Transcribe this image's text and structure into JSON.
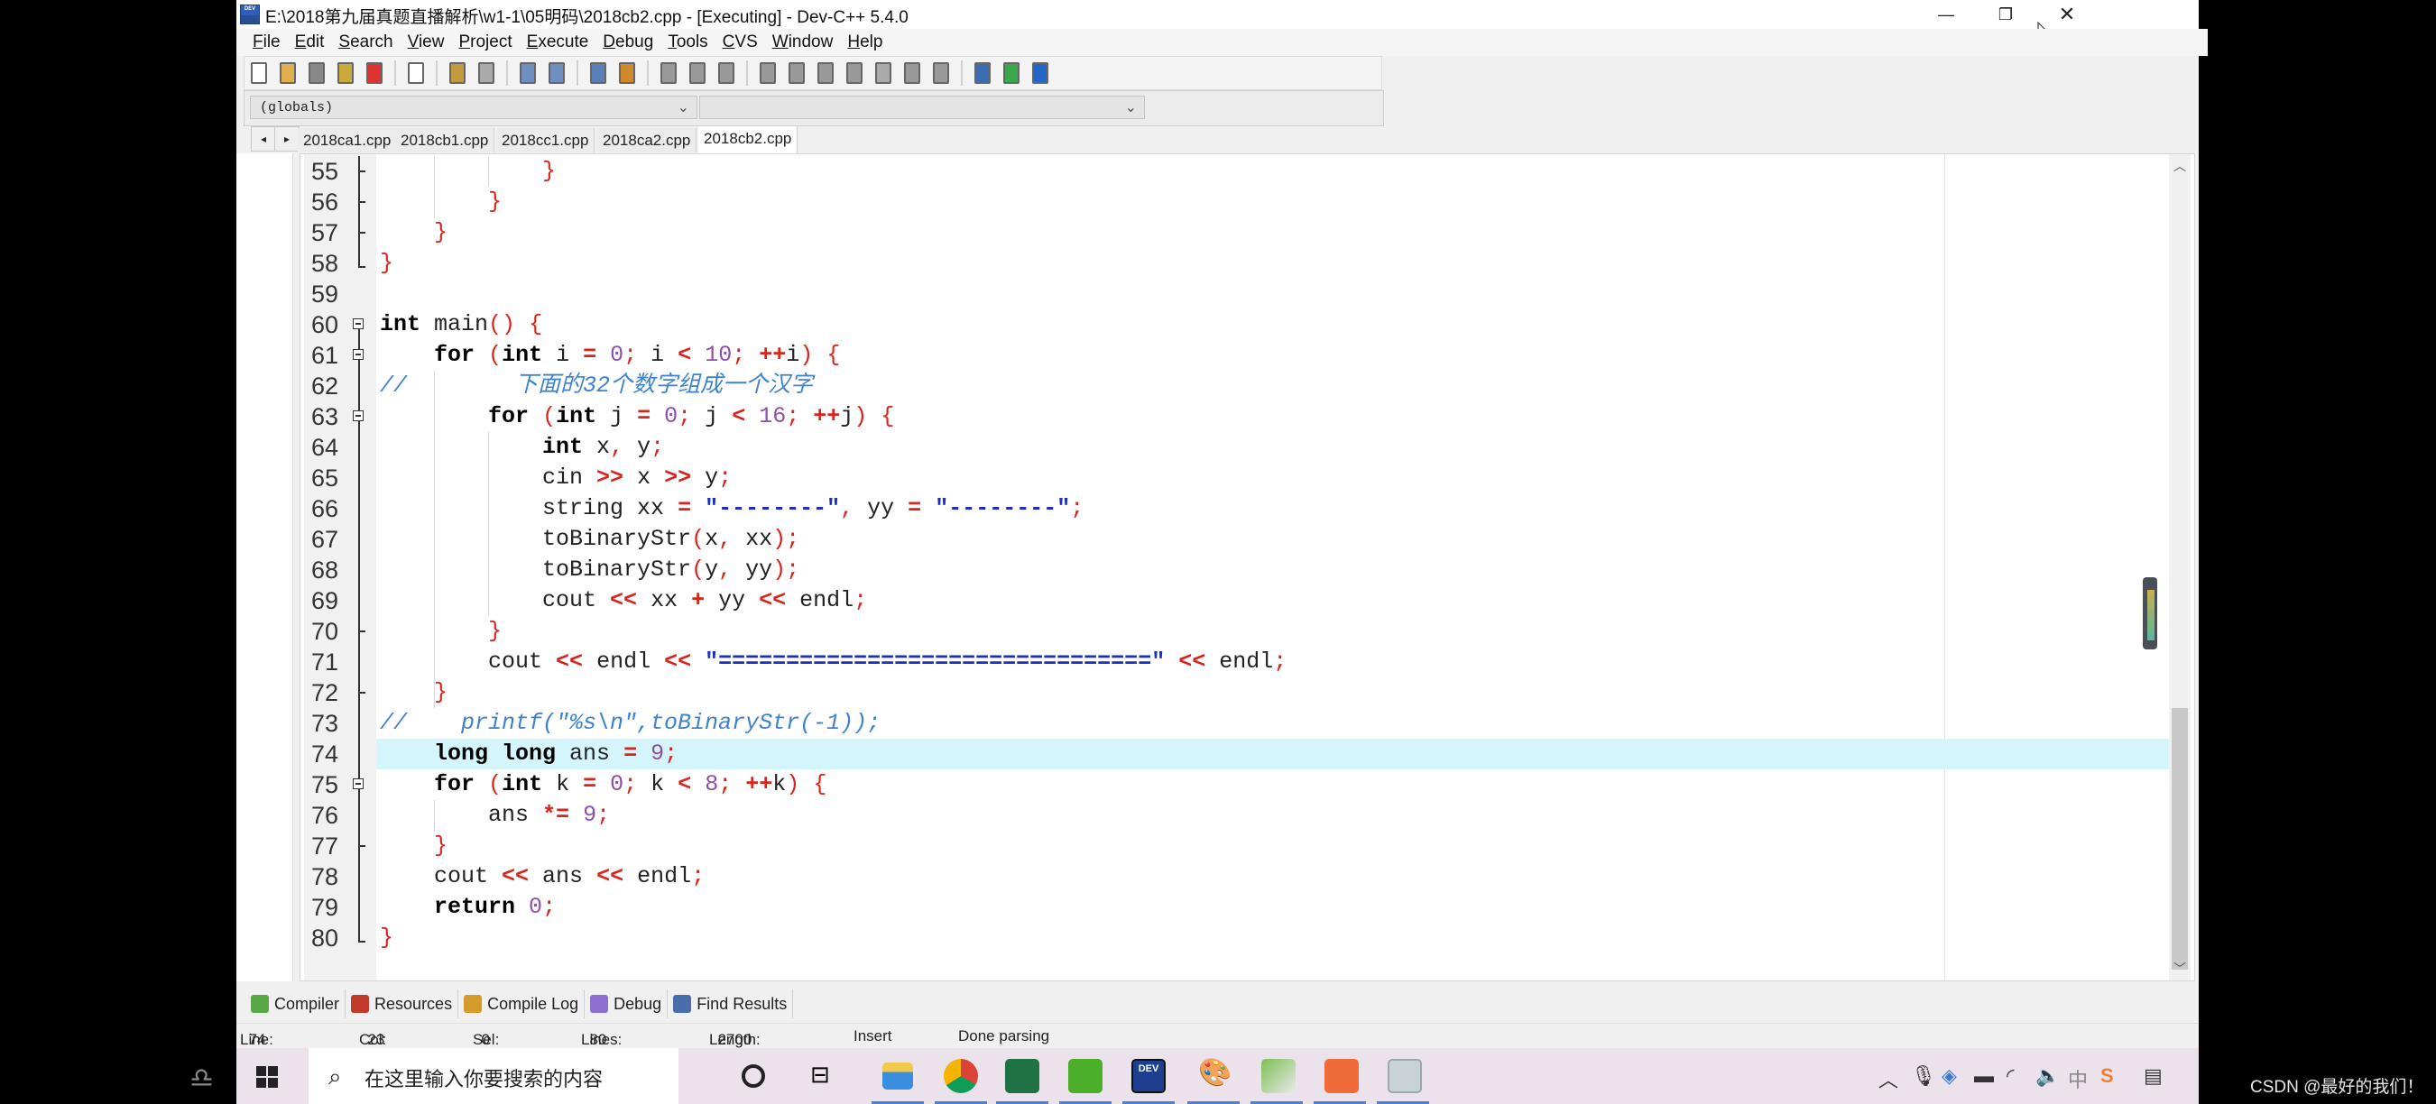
{
  "window": {
    "title": "E:\\2018第九届真题直播解析\\w1-1\\05明码\\2018cb2.cpp - [Executing] - Dev-C++ 5.4.0",
    "app_icon_text": "DEV",
    "controls": {
      "minimize": "—",
      "restore": "❐",
      "close": "✕"
    }
  },
  "menu": [
    {
      "label": "File",
      "mnemonic": "F",
      "rest": "ile"
    },
    {
      "label": "Edit",
      "mnemonic": "E",
      "rest": "dit"
    },
    {
      "label": "Search",
      "mnemonic": "S",
      "rest": "earch"
    },
    {
      "label": "View",
      "mnemonic": "V",
      "rest": "iew"
    },
    {
      "label": "Project",
      "mnemonic": "P",
      "rest": "roject"
    },
    {
      "label": "Execute",
      "mnemonic": "E",
      "rest": "xecute",
      "pre": ""
    },
    {
      "label": "Debug",
      "mnemonic": "D",
      "rest": "ebug"
    },
    {
      "label": "Tools",
      "mnemonic": "T",
      "rest": "ools"
    },
    {
      "label": "CVS",
      "mnemonic": "C",
      "rest": "VS"
    },
    {
      "label": "Window",
      "mnemonic": "W",
      "rest": "indow"
    },
    {
      "label": "Help",
      "mnemonic": "H",
      "rest": "elp"
    }
  ],
  "toolbar": {
    "groups": [
      [
        "new-file",
        "open-file",
        "save-file",
        "save-all",
        "close-file"
      ],
      [
        "print"
      ],
      [
        "undo",
        "redo"
      ],
      [
        "find",
        "replace"
      ],
      [
        "goto-line",
        "toggle-bookmark"
      ],
      [
        "indent",
        "unindent",
        "toggle-comment"
      ],
      [
        "compile",
        "run",
        "compile-run",
        "rebuild",
        "syntax-check",
        "debug",
        "stop-execution"
      ],
      [
        "new-project",
        "add-to-project",
        "project-options"
      ]
    ]
  },
  "combos": {
    "class_selector": "(globals)",
    "member_selector": ""
  },
  "file_tabs": {
    "nav_left": "◂",
    "nav_right": "▸",
    "tabs": [
      "2018ca1.cpp",
      "2018cb1.cpp",
      "2018cc1.cpp",
      "2018ca2.cpp",
      "2018cb2.cpp"
    ],
    "active": "2018cb2.cpp"
  },
  "editor": {
    "highlighted_line": 74,
    "lines": [
      {
        "num": "55",
        "fold": "mid",
        "tokens": [
          {
            "t": "            ",
            "c": ""
          },
          {
            "t": "}",
            "c": "p"
          }
        ]
      },
      {
        "num": "56",
        "fold": "mid",
        "tokens": [
          {
            "t": "        ",
            "c": ""
          },
          {
            "t": "}",
            "c": "p"
          }
        ]
      },
      {
        "num": "57",
        "fold": "mid",
        "tokens": [
          {
            "t": "    ",
            "c": ""
          },
          {
            "t": "}",
            "c": "p"
          }
        ]
      },
      {
        "num": "58",
        "fold": "end",
        "tokens": [
          {
            "t": "}",
            "c": "p"
          }
        ]
      },
      {
        "num": "59",
        "fold": "",
        "tokens": []
      },
      {
        "num": "60",
        "fold": "box",
        "tokens": [
          {
            "t": "int",
            "c": "k"
          },
          {
            "t": " main",
            "c": ""
          },
          {
            "t": "()",
            "c": "p"
          },
          {
            "t": " ",
            "c": ""
          },
          {
            "t": "{",
            "c": "p"
          }
        ]
      },
      {
        "num": "61",
        "fold": "box",
        "tokens": [
          {
            "t": "    ",
            "c": ""
          },
          {
            "t": "for",
            "c": "k"
          },
          {
            "t": " ",
            "c": ""
          },
          {
            "t": "(",
            "c": "p"
          },
          {
            "t": "int",
            "c": "k"
          },
          {
            "t": " i ",
            "c": ""
          },
          {
            "t": "=",
            "c": "o"
          },
          {
            "t": " ",
            "c": ""
          },
          {
            "t": "0",
            "c": "n"
          },
          {
            "t": ";",
            "c": "p"
          },
          {
            "t": " i ",
            "c": ""
          },
          {
            "t": "<",
            "c": "o"
          },
          {
            "t": " ",
            "c": ""
          },
          {
            "t": "10",
            "c": "n"
          },
          {
            "t": ";",
            "c": "p"
          },
          {
            "t": " ",
            "c": ""
          },
          {
            "t": "++",
            "c": "o"
          },
          {
            "t": "i",
            "c": ""
          },
          {
            "t": ")",
            "c": "p"
          },
          {
            "t": " ",
            "c": ""
          },
          {
            "t": "{",
            "c": "p"
          }
        ]
      },
      {
        "num": "62",
        "fold": "line",
        "tokens": [
          {
            "t": "//        下面的32个数字组成一个汉字",
            "c": "c"
          }
        ]
      },
      {
        "num": "63",
        "fold": "box",
        "tokens": [
          {
            "t": "        ",
            "c": ""
          },
          {
            "t": "for",
            "c": "k"
          },
          {
            "t": " ",
            "c": ""
          },
          {
            "t": "(",
            "c": "p"
          },
          {
            "t": "int",
            "c": "k"
          },
          {
            "t": " j ",
            "c": ""
          },
          {
            "t": "=",
            "c": "o"
          },
          {
            "t": " ",
            "c": ""
          },
          {
            "t": "0",
            "c": "n"
          },
          {
            "t": ";",
            "c": "p"
          },
          {
            "t": " j ",
            "c": ""
          },
          {
            "t": "<",
            "c": "o"
          },
          {
            "t": " ",
            "c": ""
          },
          {
            "t": "16",
            "c": "n"
          },
          {
            "t": ";",
            "c": "p"
          },
          {
            "t": " ",
            "c": ""
          },
          {
            "t": "++",
            "c": "o"
          },
          {
            "t": "j",
            "c": ""
          },
          {
            "t": ")",
            "c": "p"
          },
          {
            "t": " ",
            "c": ""
          },
          {
            "t": "{",
            "c": "p"
          }
        ]
      },
      {
        "num": "64",
        "fold": "line",
        "tokens": [
          {
            "t": "            ",
            "c": ""
          },
          {
            "t": "int",
            "c": "k"
          },
          {
            "t": " x",
            "c": ""
          },
          {
            "t": ",",
            "c": "p"
          },
          {
            "t": " y",
            "c": ""
          },
          {
            "t": ";",
            "c": "p"
          }
        ]
      },
      {
        "num": "65",
        "fold": "line",
        "tokens": [
          {
            "t": "            cin ",
            "c": ""
          },
          {
            "t": ">>",
            "c": "o"
          },
          {
            "t": " x ",
            "c": ""
          },
          {
            "t": ">>",
            "c": "o"
          },
          {
            "t": " y",
            "c": ""
          },
          {
            "t": ";",
            "c": "p"
          }
        ]
      },
      {
        "num": "66",
        "fold": "line",
        "tokens": [
          {
            "t": "            string xx ",
            "c": ""
          },
          {
            "t": "=",
            "c": "o"
          },
          {
            "t": " ",
            "c": ""
          },
          {
            "t": "\"--------\"",
            "c": "s"
          },
          {
            "t": ",",
            "c": "p"
          },
          {
            "t": " yy ",
            "c": ""
          },
          {
            "t": "=",
            "c": "o"
          },
          {
            "t": " ",
            "c": ""
          },
          {
            "t": "\"--------\"",
            "c": "s"
          },
          {
            "t": ";",
            "c": "p"
          }
        ]
      },
      {
        "num": "67",
        "fold": "line",
        "tokens": [
          {
            "t": "            toBinaryStr",
            "c": ""
          },
          {
            "t": "(",
            "c": "p"
          },
          {
            "t": "x",
            "c": ""
          },
          {
            "t": ",",
            "c": "p"
          },
          {
            "t": " xx",
            "c": ""
          },
          {
            "t": ");",
            "c": "p"
          }
        ]
      },
      {
        "num": "68",
        "fold": "line",
        "tokens": [
          {
            "t": "            toBinaryStr",
            "c": ""
          },
          {
            "t": "(",
            "c": "p"
          },
          {
            "t": "y",
            "c": ""
          },
          {
            "t": ",",
            "c": "p"
          },
          {
            "t": " yy",
            "c": ""
          },
          {
            "t": ");",
            "c": "p"
          }
        ]
      },
      {
        "num": "69",
        "fold": "line",
        "tokens": [
          {
            "t": "            cout ",
            "c": ""
          },
          {
            "t": "<<",
            "c": "o"
          },
          {
            "t": " xx ",
            "c": ""
          },
          {
            "t": "+",
            "c": "o"
          },
          {
            "t": " yy ",
            "c": ""
          },
          {
            "t": "<<",
            "c": "o"
          },
          {
            "t": " endl",
            "c": ""
          },
          {
            "t": ";",
            "c": "p"
          }
        ]
      },
      {
        "num": "70",
        "fold": "mid",
        "tokens": [
          {
            "t": "        ",
            "c": ""
          },
          {
            "t": "}",
            "c": "p"
          }
        ]
      },
      {
        "num": "71",
        "fold": "line",
        "tokens": [
          {
            "t": "        cout ",
            "c": ""
          },
          {
            "t": "<<",
            "c": "o"
          },
          {
            "t": " endl ",
            "c": ""
          },
          {
            "t": "<<",
            "c": "o"
          },
          {
            "t": " ",
            "c": ""
          },
          {
            "t": "\"================================\"",
            "c": "s"
          },
          {
            "t": " ",
            "c": ""
          },
          {
            "t": "<<",
            "c": "o"
          },
          {
            "t": " endl",
            "c": ""
          },
          {
            "t": ";",
            "c": "p"
          }
        ]
      },
      {
        "num": "72",
        "fold": "mid",
        "tokens": [
          {
            "t": "    ",
            "c": ""
          },
          {
            "t": "}",
            "c": "p"
          }
        ]
      },
      {
        "num": "73",
        "fold": "line",
        "tokens": [
          {
            "t": "//    printf(\"%s\\n\",toBinaryStr(-1));",
            "c": "c"
          }
        ]
      },
      {
        "num": "74",
        "fold": "line",
        "tokens": [
          {
            "t": "    ",
            "c": ""
          },
          {
            "t": "long long",
            "c": "k"
          },
          {
            "t": " ans ",
            "c": ""
          },
          {
            "t": "=",
            "c": "o"
          },
          {
            "t": " ",
            "c": ""
          },
          {
            "t": "9",
            "c": "n"
          },
          {
            "t": ";",
            "c": "p"
          }
        ]
      },
      {
        "num": "75",
        "fold": "box",
        "tokens": [
          {
            "t": "    ",
            "c": ""
          },
          {
            "t": "for",
            "c": "k"
          },
          {
            "t": " ",
            "c": ""
          },
          {
            "t": "(",
            "c": "p"
          },
          {
            "t": "int",
            "c": "k"
          },
          {
            "t": " k ",
            "c": ""
          },
          {
            "t": "=",
            "c": "o"
          },
          {
            "t": " ",
            "c": ""
          },
          {
            "t": "0",
            "c": "n"
          },
          {
            "t": ";",
            "c": "p"
          },
          {
            "t": " k ",
            "c": ""
          },
          {
            "t": "<",
            "c": "o"
          },
          {
            "t": " ",
            "c": ""
          },
          {
            "t": "8",
            "c": "n"
          },
          {
            "t": ";",
            "c": "p"
          },
          {
            "t": " ",
            "c": ""
          },
          {
            "t": "++",
            "c": "o"
          },
          {
            "t": "k",
            "c": ""
          },
          {
            "t": ")",
            "c": "p"
          },
          {
            "t": " ",
            "c": ""
          },
          {
            "t": "{",
            "c": "p"
          }
        ]
      },
      {
        "num": "76",
        "fold": "line",
        "tokens": [
          {
            "t": "        ans ",
            "c": ""
          },
          {
            "t": "*=",
            "c": "o"
          },
          {
            "t": " ",
            "c": ""
          },
          {
            "t": "9",
            "c": "n"
          },
          {
            "t": ";",
            "c": "p"
          }
        ]
      },
      {
        "num": "77",
        "fold": "mid",
        "tokens": [
          {
            "t": "    ",
            "c": ""
          },
          {
            "t": "}",
            "c": "p"
          }
        ]
      },
      {
        "num": "78",
        "fold": "line",
        "tokens": [
          {
            "t": "    cout ",
            "c": ""
          },
          {
            "t": "<<",
            "c": "o"
          },
          {
            "t": " ans ",
            "c": ""
          },
          {
            "t": "<<",
            "c": "o"
          },
          {
            "t": " endl",
            "c": ""
          },
          {
            "t": ";",
            "c": "p"
          }
        ]
      },
      {
        "num": "79",
        "fold": "line",
        "tokens": [
          {
            "t": "    ",
            "c": ""
          },
          {
            "t": "return",
            "c": "k"
          },
          {
            "t": " ",
            "c": ""
          },
          {
            "t": "0",
            "c": "n"
          },
          {
            "t": ";",
            "c": "p"
          }
        ]
      },
      {
        "num": "80",
        "fold": "end",
        "tokens": [
          {
            "t": "}",
            "c": "p"
          }
        ]
      }
    ]
  },
  "bottom_tabs": [
    {
      "label": "Compiler",
      "icon": "compiler-grid-icon"
    },
    {
      "label": "Resources",
      "icon": "resources-icon"
    },
    {
      "label": "Compile Log",
      "icon": "compile-log-chart-icon"
    },
    {
      "label": "Debug",
      "icon": "debug-check-icon"
    },
    {
      "label": "Find Results",
      "icon": "find-results-icon"
    }
  ],
  "status": {
    "line_label": "Line:",
    "line": "74",
    "col_label": "Col:",
    "col": "23",
    "sel_label": "Sel:",
    "sel": "0",
    "lines_label": "Lines:",
    "lines": "80",
    "length_label": "Length:",
    "length": "2700",
    "mode": "Insert",
    "message": "Done parsing"
  },
  "taskbar": {
    "search_placeholder": "在这里输入你要搜索的内容",
    "apps": [
      "task-view",
      "widgets",
      "file-explorer",
      "chrome",
      "excel",
      "camtasia-green",
      "dev-cpp",
      "paint",
      "image-editor",
      "camtasia-orange",
      "app-window"
    ],
    "tray": [
      "chevron-up",
      "microphone",
      "security",
      "battery",
      "wifi",
      "volume",
      "中",
      "sogou-input",
      "notifications"
    ]
  },
  "watermark": "CSDN @最好的我们！"
}
